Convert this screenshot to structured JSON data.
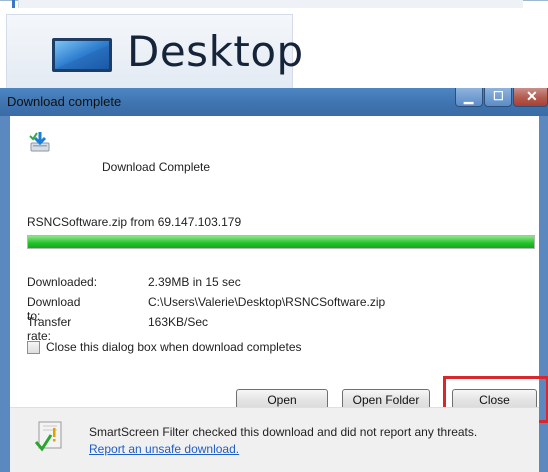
{
  "explorer": {
    "nav_item_label": "Desktop",
    "nav_item_icon": "desktop-monitor-icon"
  },
  "dialog": {
    "title": "Download complete",
    "window_controls": {
      "minimize_icon": "minimize-icon",
      "maximize_icon": "maximize-icon",
      "close_icon": "close-icon"
    },
    "heading": "Download Complete",
    "file_line": "RSNCSoftware.zip from 69.147.103.179",
    "progress_fraction": 1.0,
    "details": [
      {
        "label": "Downloaded:",
        "value": "2.39MB in 15 sec"
      },
      {
        "label": "Download to:",
        "value": "C:\\Users\\Valerie\\Desktop\\RSNCSoftware.zip"
      },
      {
        "label": "Transfer rate:",
        "value": "163KB/Sec"
      }
    ],
    "close_when_complete": {
      "label": "Close this dialog box when download completes",
      "checked": false
    },
    "buttons": {
      "open": "Open",
      "open_folder": "Open Folder",
      "close": "Close"
    },
    "smartscreen": {
      "message": "SmartScreen Filter checked this download and did not report any threats.",
      "link": "Report an unsafe download."
    }
  },
  "colors": {
    "titlebar": "#3e74b0",
    "progress_green": "#21c328",
    "highlight_red": "#d9272e",
    "link_blue": "#1f5ec9"
  }
}
